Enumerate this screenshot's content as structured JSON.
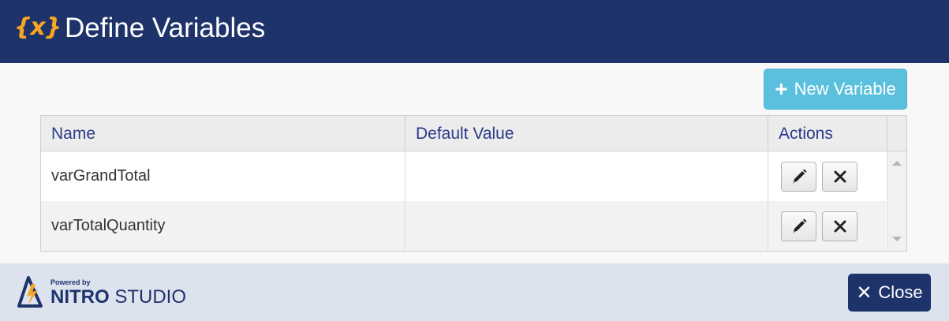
{
  "dialog": {
    "icon_text": "{x}",
    "title": "Define Variables"
  },
  "toolbar": {
    "new_variable_label": "New Variable",
    "new_variable_icon": "plus-icon"
  },
  "table": {
    "columns": [
      "Name",
      "Default Value",
      "Actions"
    ],
    "rows": [
      {
        "name": "varGrandTotal",
        "default_value": ""
      },
      {
        "name": "varTotalQuantity",
        "default_value": ""
      }
    ],
    "row_actions": [
      "edit-pencil-icon",
      "delete-x-icon"
    ]
  },
  "footer": {
    "powered_by": "Powered by",
    "brand_bold": "NITRO",
    "brand_rest": "STUDIO",
    "close_label": "Close",
    "close_icon": "close-x-icon"
  },
  "colors": {
    "header_bg": "#1f336b",
    "accent_orange": "#f5a623",
    "new_button_bg": "#5bc0de",
    "footer_bg": "#dde3ee",
    "header_text_blue": "#2a3a8a"
  }
}
